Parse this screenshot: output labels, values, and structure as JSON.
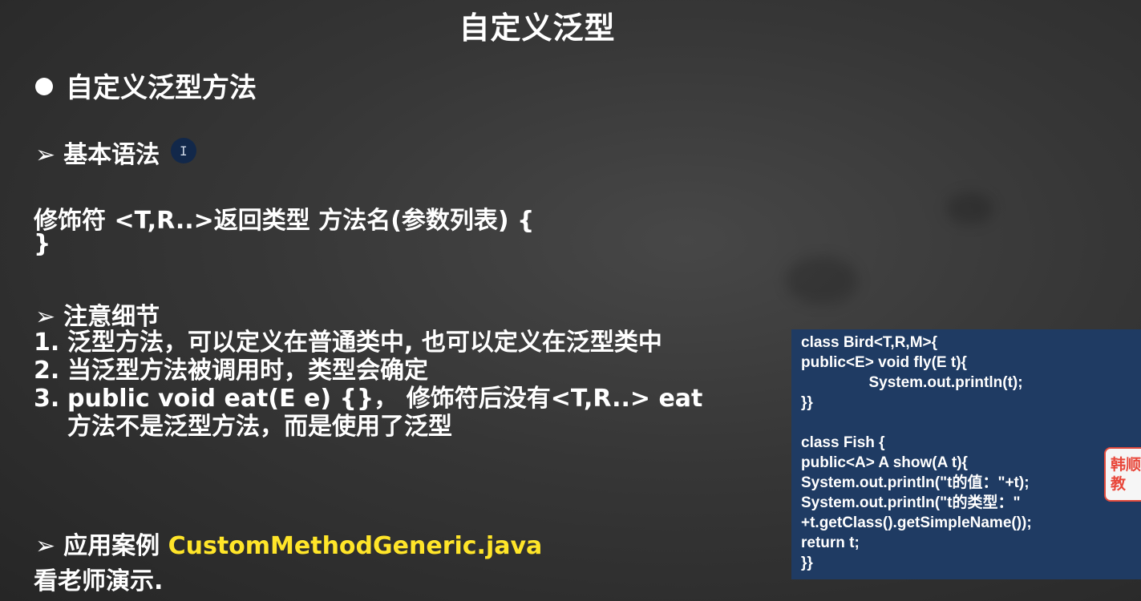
{
  "slide": {
    "title": "自定义泛型",
    "heading": "自定义泛型方法",
    "syntax_label": "基本语法",
    "syntax_line1": "修饰符 <T,R..>返回类型 方法名(参数列表) {",
    "syntax_line2": "}",
    "notes_label": "注意细节",
    "notes": [
      {
        "num": "1.",
        "text": "泛型方法，可以定义在普通类中, 也可以定义在泛型类中"
      },
      {
        "num": "2.",
        "text": "当泛型方法被调用时，类型会确定"
      },
      {
        "num": "3.",
        "text": "public void eat(E e) {}， 修饰符后没有<T,R..> eat方法不是泛型方法，而是使用了泛型"
      }
    ],
    "case_label": "应用案例",
    "case_file": "CustomMethodGeneric.java",
    "demo_text": "看老师演示."
  },
  "code_box": {
    "lines": [
      "class Bird<T,R,M>{",
      "public<E> void fly(E t){",
      "                System.out.println(t);",
      "}}",
      "",
      "class Fish {",
      "public<A> A show(A t){",
      "System.out.println(\"t的值：\"+t);",
      "System.out.println(\"t的类型：\"",
      "+t.getClass().getSimpleName());",
      "return t;",
      "}}"
    ]
  },
  "badge": {
    "line1": "韩顺",
    "line2": "教"
  },
  "icons": {
    "bullet": "filled-circle",
    "sub_bullet": "arrow-right-icon",
    "cursor": "text-cursor-icon"
  },
  "colors": {
    "highlight": "#ffe529",
    "code_background": "#1f3b63"
  }
}
